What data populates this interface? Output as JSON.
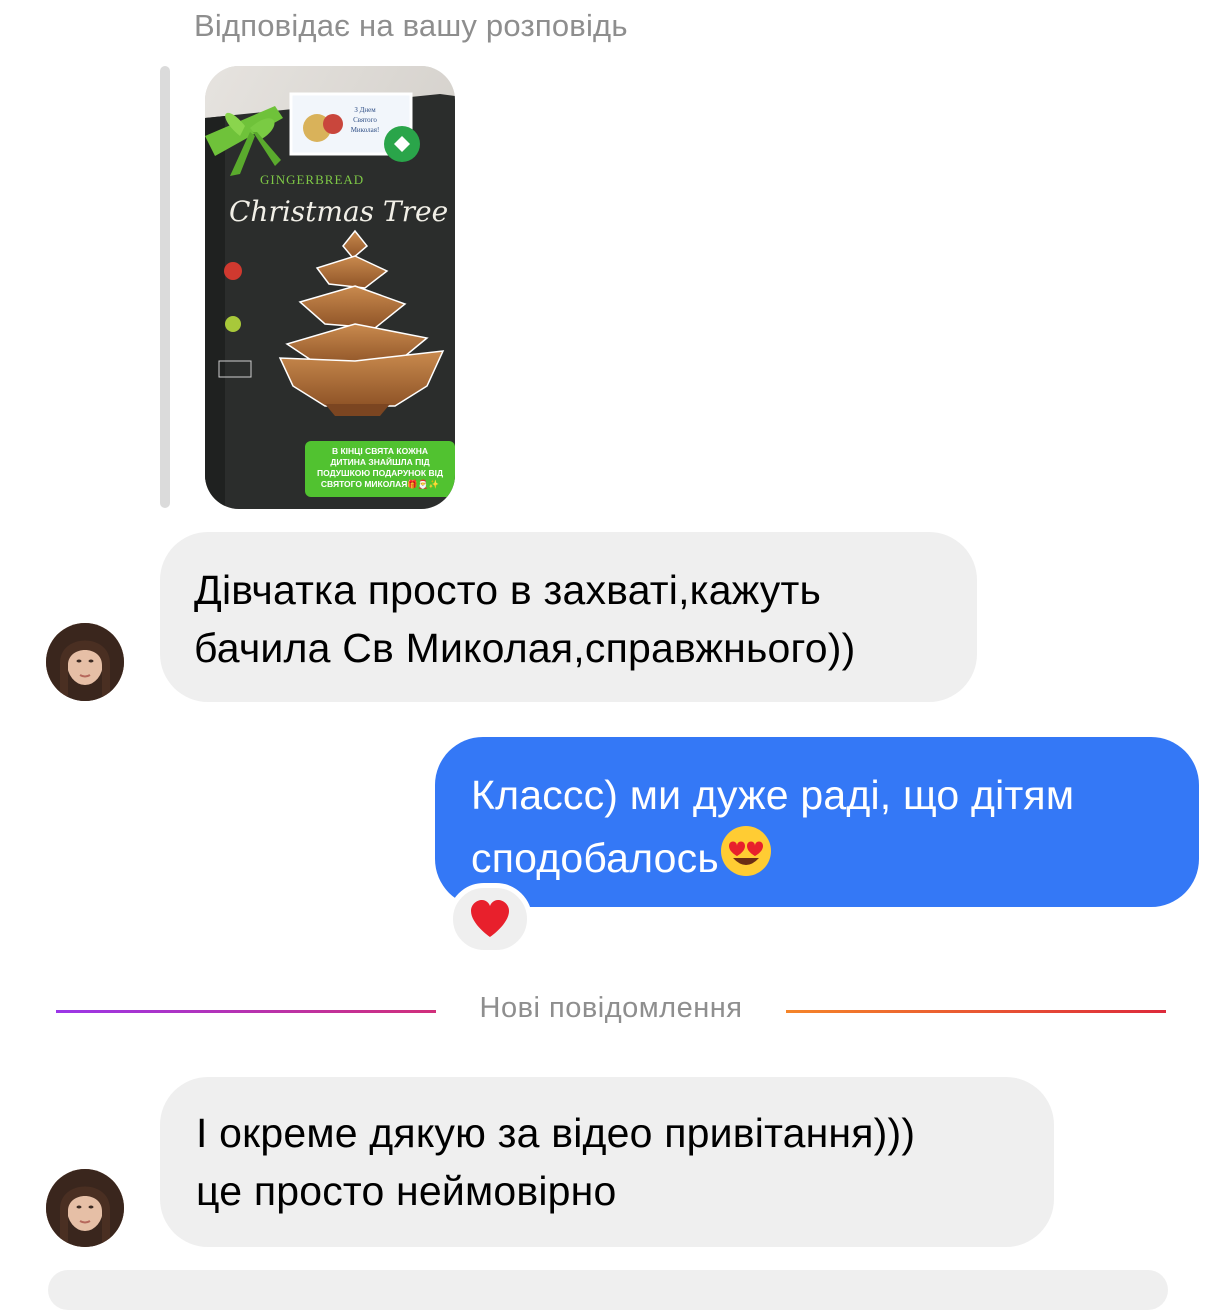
{
  "reply_caption": "Відповідає на вашу розповідь",
  "story": {
    "package_top_text": "GINGERBREAD",
    "package_title": "Christmas Tree",
    "sticker_text": "З Днем Святого Миколая!",
    "caption": "В КІНЦІ СВЯТА КОЖНА ДИТИНА ЗНАЙШЛА ПІД ПОДУШКОЮ ПОДАРУНОК ВІД СВЯТОГО МИКОЛАЯ🎁🎅✨"
  },
  "messages": [
    {
      "direction": "incoming",
      "lines": [
        "Дівчатка просто в захваті,кажуть",
        "бачила Св Миколая,справжнього))"
      ]
    },
    {
      "direction": "outgoing",
      "lines": [
        "Классс) ми дуже раді, що дітям",
        "сподобалось"
      ],
      "emoji": "heart-eyes-emoji",
      "reaction": "red-heart-emoji"
    },
    {
      "direction": "incoming",
      "lines": [
        "І окреме дякую за відео привітання)))",
        "це просто неймовірно"
      ]
    }
  ],
  "divider_label": "Нові повідомлення",
  "colors": {
    "outgoing_bubble": "#3478f6",
    "incoming_bubble": "#efefef",
    "muted_text": "#8e8e8e",
    "reaction_heart": "#e8202c"
  }
}
